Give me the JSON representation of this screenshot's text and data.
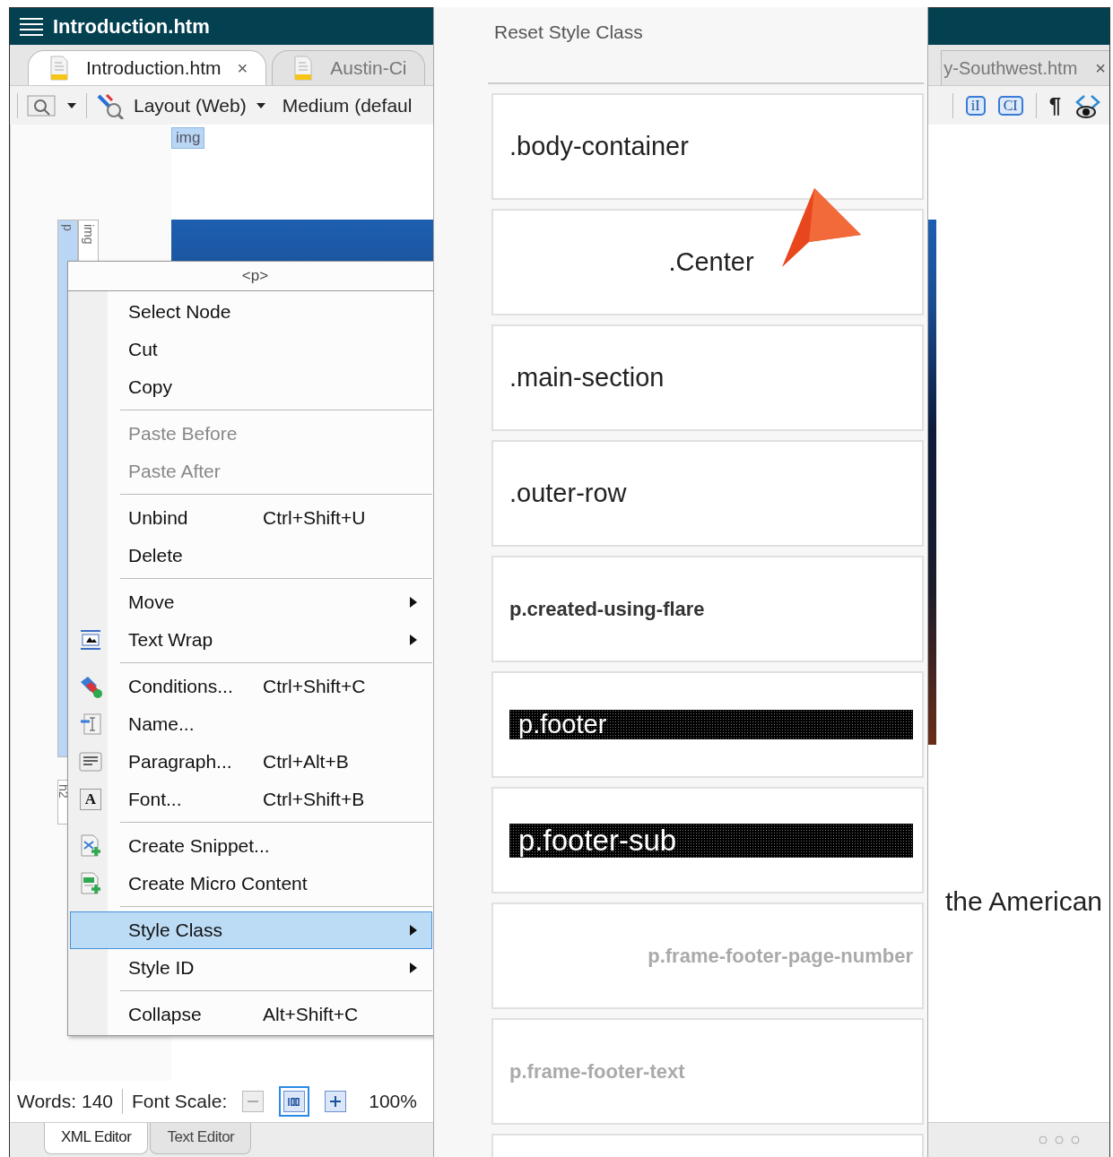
{
  "window": {
    "title": "Introduction.htm"
  },
  "tabs": [
    {
      "label": "Introduction.htm",
      "selected": true,
      "close": "×"
    },
    {
      "label": "Austin-Ci",
      "selected": false
    },
    {
      "label": "y-Southwest.htm",
      "selected": false,
      "close": "×"
    }
  ],
  "toolbar": {
    "layout": "Layout (Web)",
    "medium": "Medium (defaul",
    "inline_tag": "iI",
    "class_tag": "CI",
    "paragraph_mark": "¶"
  },
  "structure_bar": {
    "top_tag": "img",
    "side_tags": [
      {
        "label": "p",
        "selected": true
      },
      {
        "label": "img",
        "selected": false
      },
      {
        "label": "h2",
        "selected": false
      }
    ]
  },
  "document": {
    "text": "the American"
  },
  "context_menu": {
    "header": "<p>",
    "items": [
      {
        "kind": "item",
        "label": "Select Node",
        "disabled": false,
        "selected": false,
        "submenu": false
      },
      {
        "kind": "item",
        "label": "Cut",
        "disabled": false,
        "selected": false,
        "submenu": false
      },
      {
        "kind": "item",
        "label": "Copy",
        "disabled": false,
        "selected": false,
        "submenu": false
      },
      {
        "kind": "separator"
      },
      {
        "kind": "item",
        "label": "Paste Before",
        "disabled": true,
        "selected": false,
        "submenu": false
      },
      {
        "kind": "item",
        "label": "Paste After",
        "disabled": true,
        "selected": false,
        "submenu": false
      },
      {
        "kind": "separator"
      },
      {
        "kind": "item",
        "label": "Unbind",
        "shortcut": "Ctrl+Shift+U",
        "disabled": false,
        "selected": false,
        "submenu": false
      },
      {
        "kind": "item",
        "label": "Delete",
        "disabled": false,
        "selected": false,
        "submenu": false
      },
      {
        "kind": "separator"
      },
      {
        "kind": "item",
        "label": "Move",
        "disabled": false,
        "selected": false,
        "submenu": true
      },
      {
        "kind": "item",
        "label": "Text Wrap",
        "disabled": false,
        "selected": false,
        "submenu": true
      },
      {
        "kind": "separator"
      },
      {
        "kind": "item",
        "label": "Conditions...",
        "shortcut": "Ctrl+Shift+C",
        "disabled": false,
        "selected": false,
        "submenu": false
      },
      {
        "kind": "item",
        "label": "Name...",
        "disabled": false,
        "selected": false,
        "submenu": false
      },
      {
        "kind": "item",
        "label": "Paragraph...",
        "shortcut": "Ctrl+Alt+B",
        "disabled": false,
        "selected": false,
        "submenu": false
      },
      {
        "kind": "item",
        "label": "Font...",
        "shortcut": "Ctrl+Shift+B",
        "icon_text": "A",
        "disabled": false,
        "selected": false,
        "submenu": false
      },
      {
        "kind": "separator"
      },
      {
        "kind": "item",
        "label": "Create Snippet...",
        "disabled": false,
        "selected": false,
        "submenu": false
      },
      {
        "kind": "item",
        "label": "Create Micro Content",
        "disabled": false,
        "selected": false,
        "submenu": false
      },
      {
        "kind": "separator"
      },
      {
        "kind": "item",
        "label": "Style Class",
        "disabled": false,
        "selected": true,
        "submenu": true
      },
      {
        "kind": "item",
        "label": "Style ID",
        "disabled": false,
        "selected": false,
        "submenu": true
      },
      {
        "kind": "separator"
      },
      {
        "kind": "item",
        "label": "Collapse",
        "shortcut": "Alt+Shift+C",
        "disabled": false,
        "selected": false,
        "submenu": false
      }
    ]
  },
  "style_class_panel": {
    "title": "Reset Style Class",
    "items": [
      {
        "label": ".body-container",
        "kind": "plain",
        "highlighted": false,
        "disabled": false
      },
      {
        "label": ".Center",
        "kind": "plain",
        "highlighted": false,
        "disabled": false
      },
      {
        "label": ".main-section",
        "kind": "plain",
        "highlighted": false,
        "disabled": false
      },
      {
        "label": ".outer-row",
        "kind": "plain",
        "highlighted": false,
        "disabled": false
      },
      {
        "label": "p.created-using-flare",
        "kind": "bold",
        "highlighted": false,
        "disabled": false
      },
      {
        "label": "p.footer",
        "kind": "plain",
        "highlighted": true,
        "disabled": false
      },
      {
        "label": "p.footer-sub",
        "kind": "large",
        "highlighted": true,
        "disabled": false
      },
      {
        "label": "p.frame-footer-page-number",
        "kind": "bold",
        "highlighted": false,
        "disabled": true
      },
      {
        "label": "p.frame-footer-text",
        "kind": "bold",
        "highlighted": false,
        "disabled": true
      },
      {
        "kind": "empty"
      }
    ]
  },
  "status_bar": {
    "words": "Words: 140",
    "font_scale_label": "Font Scale:",
    "scale_buttons": [
      {
        "selected": false,
        "disabled": true
      },
      {
        "selected": true,
        "disabled": false
      },
      {
        "selected": false,
        "disabled": false
      }
    ],
    "zoom": "100%"
  },
  "editor_tabs": [
    {
      "label": "XML Editor",
      "selected": true
    },
    {
      "label": "Text Editor",
      "selected": false
    }
  ]
}
